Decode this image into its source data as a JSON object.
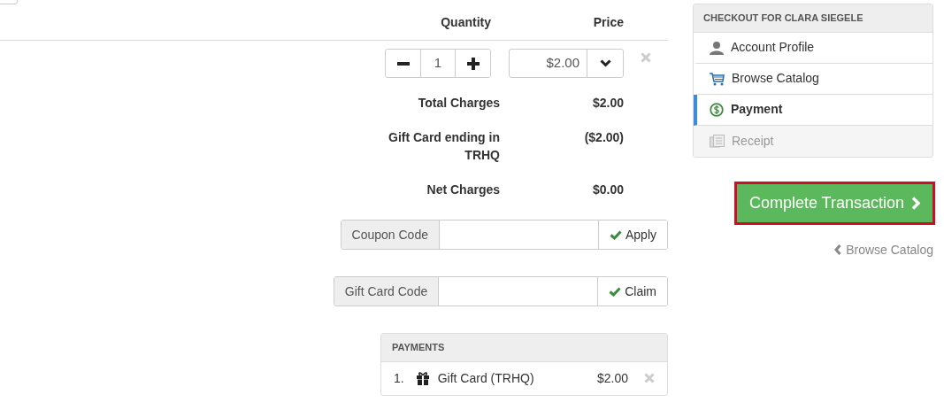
{
  "headers": [
    "Quantity",
    "Price"
  ],
  "item": {
    "quantity": "1",
    "price": "$2.00"
  },
  "summary": [
    {
      "label": "Total Charges",
      "value": "$2.00"
    },
    {
      "label": "Gift Card ending in TRHQ",
      "value": "($2.00)"
    },
    {
      "label": "Net Charges",
      "value": "$0.00"
    }
  ],
  "coupon": {
    "label": "Coupon Code",
    "button": "Apply"
  },
  "gift_card": {
    "label": "Gift Card Code",
    "button": "Claim"
  },
  "payments": {
    "title": "PAYMENTS",
    "rows": [
      {
        "number": "1.",
        "name": "Gift Card (TRHQ)",
        "amount": "$2.00"
      }
    ]
  },
  "sidebar": {
    "title": "CHECKOUT FOR CLARA SIEGELE",
    "items": [
      {
        "kind": "profile",
        "label": "Account Profile",
        "selected": false,
        "disabled": false
      },
      {
        "kind": "catalog",
        "label": "Browse Catalog",
        "selected": false,
        "disabled": false
      },
      {
        "kind": "payment",
        "label": "Payment",
        "selected": true,
        "disabled": false
      },
      {
        "kind": "receipt",
        "label": "Receipt",
        "selected": false,
        "disabled": true
      }
    ]
  },
  "complete_button": "Complete Transaction",
  "back_link": "Browse Catalog"
}
